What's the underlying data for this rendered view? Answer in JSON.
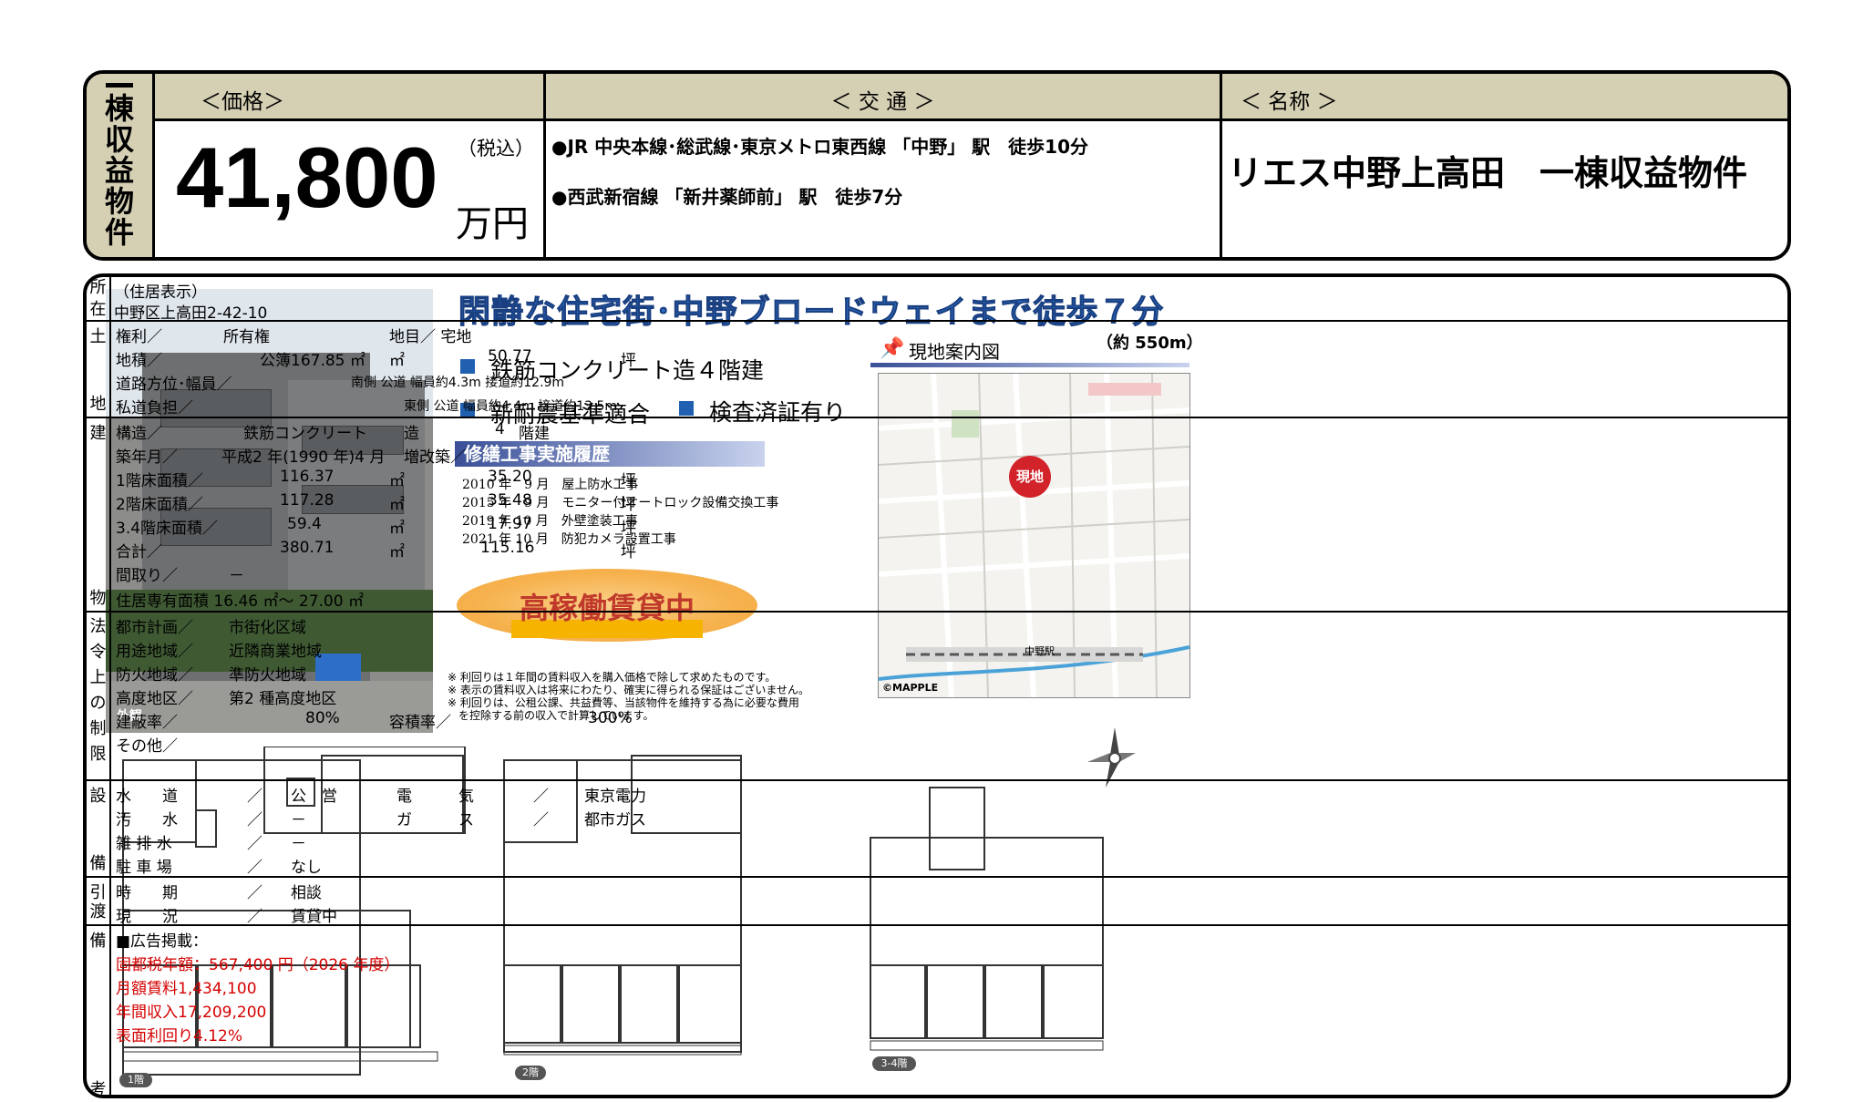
{
  "header": {
    "vertical_title": [
      "一",
      "棟",
      "収",
      "益",
      "物",
      "件"
    ],
    "price_caption": "＜価格＞",
    "tax_label": "（税込）",
    "price_value": "41,800",
    "price_unit": "万円",
    "traffic_caption": "＜ 交 通 ＞",
    "traffic_lines": [
      "●JR 中央本線･総武線･東京メトロ東西線 「中野」 駅　徒歩10分",
      "●西武新宿線 「新井薬師前」 駅　徒歩7分"
    ],
    "name_caption": "＜ 名称 ＞",
    "name": "リエス中野上高田　一棟収益物件"
  },
  "flyer": {
    "headline": "閑静な住宅街･中野ブロードウェイまで徒歩７分",
    "distance": "（約 550m）",
    "feature_1": "鉄筋コンクリート造４階建",
    "feature_2": "新耐震基準適合",
    "feature_3": "検査済証有り",
    "repair_title": "修繕工事実施履歴",
    "repairs": [
      "2010 年　9 月　屋上防水工事",
      "2015 年　9 月　モニター付オートロック設備交換工事",
      "2019 年 10 月　外壁塗装工事",
      "2021 年 10 月　防犯カメラ設置工事"
    ],
    "occupancy_badge": "高稼働賃貸中",
    "notes": [
      "※ 利回りは１年間の賃料収入を購入価格で除して求めたものです。",
      "※ 表示の賃料収入は将来にわたり、確実に得られる保証はございません。",
      "※ 利回りは、公租公課、共益費等、当該物件を維持する為に必要な費用",
      "　を控除する前の収入で計算しています。"
    ],
    "photo_label": "外観",
    "map_title": "現地案内図",
    "map_marker": "現地",
    "map_credit": "©MAPPLE",
    "map_station": "中野駅",
    "floor_1": "1階",
    "floor_2": "2階",
    "floor_34": "3-4階"
  },
  "details": {
    "location": {
      "label": "所在",
      "line_1": "（住居表示）",
      "line_2": "中野区上高田2-42-10"
    },
    "land": {
      "label_top": "土",
      "label_bottom": "地",
      "right_label": "権利／",
      "right_value": "所有権",
      "chimoku": "地目／ 宅地",
      "area_label": "地積／",
      "area_value": "公簿167.85 ㎡",
      "area_unit": "㎡",
      "area_tsubo": "50.77",
      "tsubo": "坪",
      "road_label": "道路方位･幅員／",
      "road_1": "南側 公道 幅員約4.3m 接道約12.9m",
      "private_road": "私道負担／",
      "road_2": "東側 公道 幅員約4.4m 接道約13.5m"
    },
    "building": {
      "label_top": "建",
      "label_bottom": "物",
      "structure_label": "構造／",
      "structure_value": "鉄筋コンクリート",
      "structure_zou": "造",
      "floors_num": "4",
      "floors_unit": "階建",
      "built_label": "築年月／",
      "built_value": "平成2 年(1990 年)4 月",
      "extension": "増改築／",
      "rows": [
        {
          "label": "1階床面積／",
          "sqm": "116.37",
          "m2": "㎡",
          "tsubo": "35.20",
          "t": "坪"
        },
        {
          "label": "2階床面積／",
          "sqm": "117.28",
          "m2": "㎡",
          "tsubo": "35.48",
          "t": "坪"
        },
        {
          "label": "3.4階床面積／",
          "sqm": "59.4",
          "m2": "㎡",
          "tsubo": "17.97",
          "t": "坪"
        },
        {
          "label": "合計／",
          "sqm": "380.71",
          "m2": "㎡",
          "tsubo": "115.16",
          "t": "坪"
        }
      ],
      "layout_label": "間取り／",
      "layout_value": "－",
      "exclusive_area": "住居専有面積 16.46 ㎡～ 27.00 ㎡"
    },
    "regulations": {
      "labels": [
        "法",
        "令",
        "上",
        "の",
        "制",
        "限"
      ],
      "city_plan": "都市計画／",
      "city_plan_value": "市街化区域",
      "use_zone": "用途地域／",
      "use_zone_value": "近隣商業地域",
      "fire_zone": "防火地域／",
      "fire_zone_value": "準防火地域",
      "height_zone": "高度地区／",
      "height_zone_value": "第2 種高度地区",
      "coverage": "建蔽率／",
      "coverage_value": "80%",
      "far": "容積率／",
      "far_value": "300%",
      "other": "その他／"
    },
    "facilities": {
      "label_top": "設",
      "label_bottom": "備",
      "rows": [
        {
          "a": "水　　道",
          "b": "／",
          "c": "公　営"
        },
        {
          "a": "汚　　水",
          "b": "／",
          "c": "－"
        },
        {
          "a": "雑 排 水",
          "b": "／",
          "c": "－"
        },
        {
          "a": "駐 車 場",
          "b": "／",
          "c": "なし"
        }
      ],
      "elec_label": "電　　　気",
      "elec_sep": "／",
      "elec_value": "東京電力",
      "gas_label": "ガ　　　ス",
      "gas_sep": "／",
      "gas_value": "都市ガス"
    },
    "handover": {
      "label_top": "引",
      "label_bottom": "渡",
      "time_label": "時　　期",
      "time_sep": "／",
      "time_value": "相談",
      "status_label": "現　　況",
      "status_sep": "／",
      "status_value": "賃貸中"
    },
    "remarks": {
      "label_top": "備",
      "label_bottom": "考",
      "ad": "■広告掲載：",
      "tax": "固都税年額：567,400 円（2026 年度）",
      "monthly": "月額賃料1,434,100",
      "annual": "年間収入17,209,200",
      "yield": "表面利回り4.12%"
    }
  },
  "colors": {
    "caption_bg": "#d5cfb3",
    "headline_blue": "#2e6fc4",
    "badge_orange": "#f6b24e",
    "badge_text": "#c0392b",
    "remarks_red": "#d40000"
  }
}
